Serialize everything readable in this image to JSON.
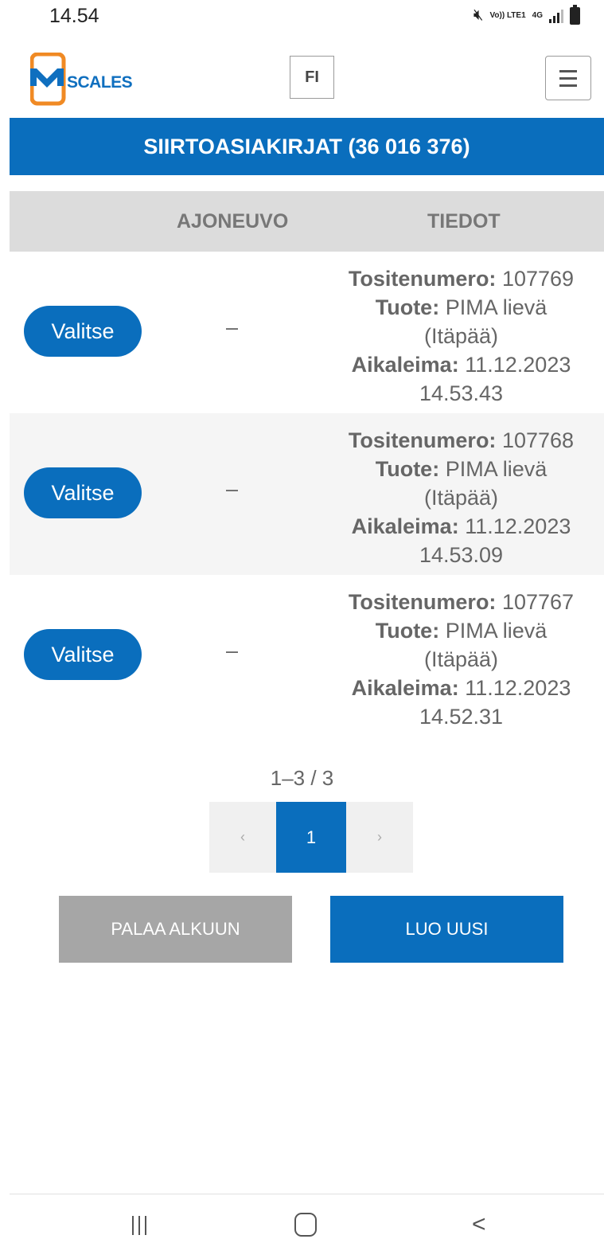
{
  "status_bar": {
    "time": "14.54",
    "volte": "Vo)) LTE1",
    "network": "4G"
  },
  "header": {
    "logo_text": "SCALES",
    "language": "FI",
    "colors": {
      "brand_orange": "#f08a24",
      "brand_blue": "#0a6ebd"
    }
  },
  "page": {
    "title": "SIIRTOASIAKIRJAT (36 016 376)"
  },
  "table": {
    "columns": [
      "AJONEUVO",
      "TIEDOT"
    ],
    "select_label": "Valitse",
    "rows": [
      {
        "vehicle": "–",
        "voucher_label": "Tositenumero:",
        "voucher": "107769",
        "product_label": "Tuote:",
        "product": "PIMA lievä (Itäpää)",
        "timestamp_label": "Aikaleima:",
        "timestamp": "11.12.2023 14.53.43"
      },
      {
        "vehicle": "–",
        "voucher_label": "Tositenumero:",
        "voucher": "107768",
        "product_label": "Tuote:",
        "product": "PIMA lievä (Itäpää)",
        "timestamp_label": "Aikaleima:",
        "timestamp": "11.12.2023 14.53.09"
      },
      {
        "vehicle": "–",
        "voucher_label": "Tositenumero:",
        "voucher": "107767",
        "product_label": "Tuote:",
        "product": "PIMA lievä (Itäpää)",
        "timestamp_label": "Aikaleima:",
        "timestamp": "11.12.2023 14.52.31"
      }
    ]
  },
  "pagination": {
    "summary": "1–3 / 3",
    "prev": "‹",
    "current": "1",
    "next": "›"
  },
  "actions": {
    "back_label": "PALAA ALKUUN",
    "new_label": "LUO UUSI"
  }
}
